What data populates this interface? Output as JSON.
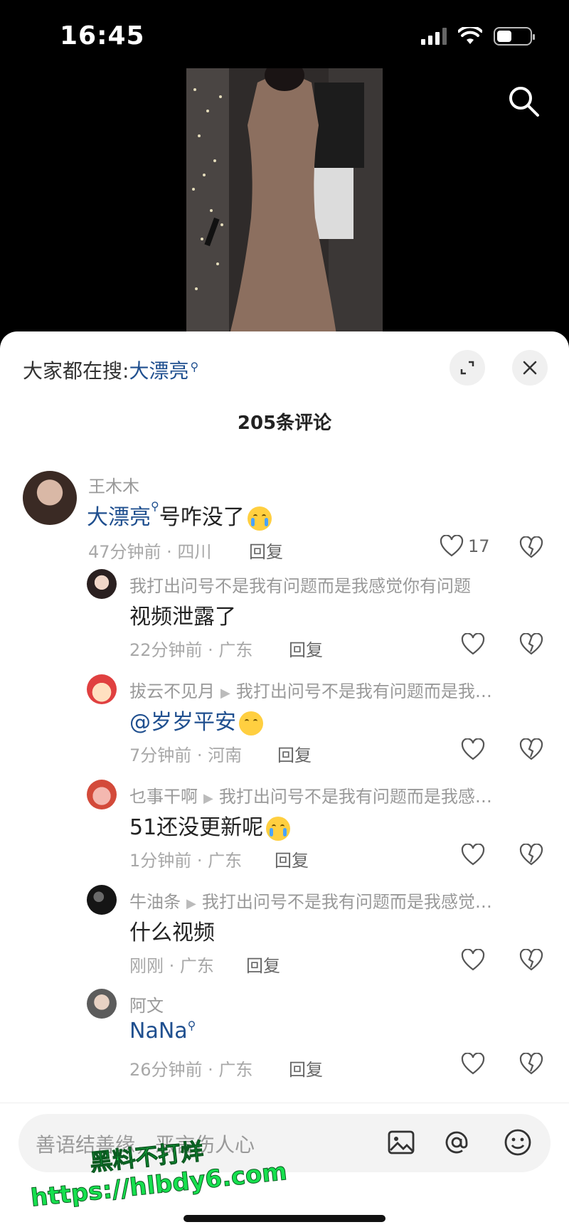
{
  "status": {
    "time": "16:45"
  },
  "sheet": {
    "trending_prefix": "大家都在搜:",
    "trending_keyword": "大漂亮",
    "comment_count": "205条评论"
  },
  "comments": [
    {
      "name": "王木木",
      "link": "大漂亮",
      "text": "号咋没了",
      "emoji": "crying",
      "meta": "47分钟前 · 四川",
      "reply": "回复",
      "likes": "17"
    },
    {
      "name": "我打出问号不是我有问题而是我感觉你有问题",
      "text": "视频泄露了",
      "meta": "22分钟前 · 广东",
      "reply": "回复"
    },
    {
      "name": "拔云不见月",
      "reply_to": "我打出问号不是我有问题而是我…",
      "link": "@岁岁平安",
      "emoji": "flushed",
      "meta": "7分钟前 · 河南",
      "reply": "回复"
    },
    {
      "name": "乜事干啊",
      "reply_to": "我打出问号不是我有问题而是我感…",
      "text": "51还没更新呢",
      "emoji": "crying",
      "meta": "1分钟前 · 广东",
      "reply": "回复"
    },
    {
      "name": "牛油条",
      "reply_to": "我打出问号不是我有问题而是我感觉…",
      "text": "什么视频",
      "meta": "刚刚 · 广东",
      "reply": "回复"
    },
    {
      "name": "阿文",
      "link": "NaNa",
      "meta": "26分钟前 · 广东",
      "reply": "回复"
    }
  ],
  "input": {
    "placeholder": "善语结善缘，恶言伤人心"
  },
  "watermark": {
    "line1": "黑料不打烊",
    "line2": "https://hlbdy6.com"
  },
  "colors": {
    "link": "#1f4f8f",
    "sheet_bg": "#ffffff",
    "watermark": "#16e04e"
  }
}
